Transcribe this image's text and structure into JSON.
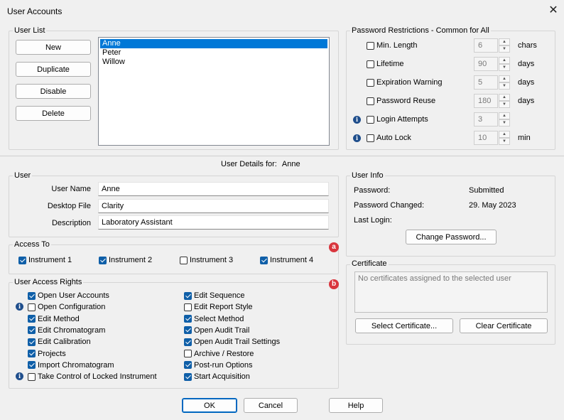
{
  "window": {
    "title": "User Accounts",
    "close_glyph": "✕"
  },
  "user_list": {
    "group_label": "User List",
    "buttons": {
      "new": "New",
      "duplicate": "Duplicate",
      "disable": "Disable",
      "delete": "Delete"
    },
    "users": [
      "Anne",
      "Peter",
      "Willow"
    ],
    "selected": "Anne"
  },
  "password_restrictions": {
    "group_label": "Password Restrictions - Common for All",
    "rows": [
      {
        "label": "Min. Length",
        "checked": false,
        "value": "6",
        "unit": "chars",
        "info": false
      },
      {
        "label": "Lifetime",
        "checked": false,
        "value": "90",
        "unit": "days",
        "info": false
      },
      {
        "label": "Expiration Warning",
        "checked": false,
        "value": "5",
        "unit": "days",
        "info": false
      },
      {
        "label": "Password Reuse",
        "checked": false,
        "value": "180",
        "unit": "days",
        "info": false
      },
      {
        "label": "Login Attempts",
        "checked": false,
        "value": "3",
        "unit": "",
        "info": true
      },
      {
        "label": "Auto Lock",
        "checked": false,
        "value": "10",
        "unit": "min",
        "info": true
      }
    ]
  },
  "details_header": {
    "label": "User Details for:",
    "user": "Anne"
  },
  "user": {
    "group_label": "User",
    "user_name_label": "User Name",
    "user_name": "Anne",
    "desktop_file_label": "Desktop File",
    "desktop_file": "Clarity",
    "description_label": "Description",
    "description": "Laboratory Assistant"
  },
  "user_info": {
    "group_label": "User Info",
    "password_label": "Password:",
    "password_value": "Submitted",
    "changed_label": "Password Changed:",
    "changed_value": "29. May 2023",
    "last_login_label": "Last Login:",
    "last_login_value": "",
    "change_password_button": "Change Password..."
  },
  "access_to": {
    "group_label": "Access To",
    "instruments": [
      {
        "label": "Instrument 1",
        "checked": true
      },
      {
        "label": "Instrument 2",
        "checked": true
      },
      {
        "label": "Instrument 3",
        "checked": false
      },
      {
        "label": "Instrument 4",
        "checked": true
      }
    ],
    "marker": "a"
  },
  "access_rights": {
    "group_label": "User Access Rights",
    "marker": "b",
    "left": [
      {
        "label": "Open User Accounts",
        "checked": true,
        "info": false
      },
      {
        "label": "Open Configuration",
        "checked": false,
        "info": true
      },
      {
        "label": "Edit Method",
        "checked": true,
        "info": false
      },
      {
        "label": "Edit Chromatogram",
        "checked": true,
        "info": false
      },
      {
        "label": "Edit Calibration",
        "checked": true,
        "info": false
      },
      {
        "label": "Projects",
        "checked": true,
        "info": false
      },
      {
        "label": "Import Chromatogram",
        "checked": true,
        "info": false
      },
      {
        "label": "Take Control of Locked Instrument",
        "checked": false,
        "info": true
      }
    ],
    "right": [
      {
        "label": "Edit Sequence",
        "checked": true
      },
      {
        "label": "Edit Report Style",
        "checked": false
      },
      {
        "label": "Select Method",
        "checked": true
      },
      {
        "label": "Open Audit Trail",
        "checked": true
      },
      {
        "label": "Open Audit Trail Settings",
        "checked": true
      },
      {
        "label": "Archive / Restore",
        "checked": false
      },
      {
        "label": "Post-run Options",
        "checked": true
      },
      {
        "label": "Start Acquisition",
        "checked": true
      }
    ]
  },
  "certificate": {
    "group_label": "Certificate",
    "empty_text": "No certificates assigned to the selected user",
    "select_button": "Select Certificate...",
    "clear_button": "Clear Certificate"
  },
  "footer": {
    "ok": "OK",
    "cancel": "Cancel",
    "help": "Help"
  },
  "colors": {
    "accent": "#0f5fa8",
    "selection": "#0078d7",
    "marker": "#d9363e",
    "info": "#1f4e8c"
  }
}
